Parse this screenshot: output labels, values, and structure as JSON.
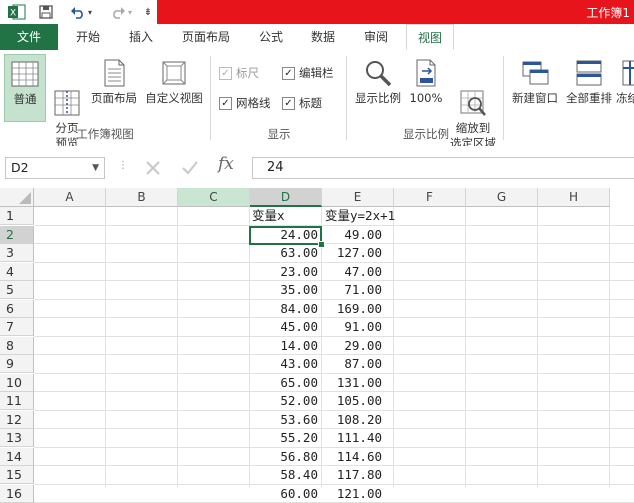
{
  "title_bar": {
    "title": "工作簿1"
  },
  "tabs": [
    "文件",
    "开始",
    "插入",
    "页面布局",
    "公式",
    "数据",
    "审阅",
    "视图"
  ],
  "ribbon": {
    "workbook_views": {
      "group_label": "工作簿视图",
      "buttons": [
        "普通",
        "分页\n预览",
        "页面布局",
        "自定义视图"
      ]
    },
    "show": {
      "group_label": "显示",
      "checkboxes": [
        {
          "label": "标尺",
          "checked": true,
          "disabled": true
        },
        {
          "label": "编辑栏",
          "checked": true,
          "disabled": false
        },
        {
          "label": "网格线",
          "checked": true,
          "disabled": false
        },
        {
          "label": "标题",
          "checked": true,
          "disabled": false
        }
      ]
    },
    "zoom": {
      "group_label": "显示比例",
      "buttons": [
        "显示比例",
        "100%",
        "缩放到\n选定区域"
      ]
    },
    "window": {
      "buttons": [
        "新建窗口",
        "全部重排",
        "冻结"
      ]
    }
  },
  "formula_bar": {
    "name_box": "D2",
    "fx": "fx",
    "value": "24"
  },
  "grid": {
    "columns": [
      "A",
      "B",
      "C",
      "D",
      "E",
      "F",
      "G",
      "H"
    ],
    "rows": [
      "1",
      "2",
      "3",
      "4",
      "5",
      "6",
      "7",
      "8",
      "9",
      "10",
      "11",
      "12",
      "13",
      "14",
      "15",
      "16"
    ],
    "header_row": {
      "D": "变量x",
      "E": "变量y=2x+1"
    },
    "data": [
      [
        "24.00",
        "49.00"
      ],
      [
        "63.00",
        "127.00"
      ],
      [
        "23.00",
        "47.00"
      ],
      [
        "35.00",
        "71.00"
      ],
      [
        "84.00",
        "169.00"
      ],
      [
        "45.00",
        "91.00"
      ],
      [
        "14.00",
        "29.00"
      ],
      [
        "43.00",
        "87.00"
      ],
      [
        "65.00",
        "131.00"
      ],
      [
        "52.00",
        "105.00"
      ],
      [
        "53.60",
        "108.20"
      ],
      [
        "55.20",
        "111.40"
      ],
      [
        "56.80",
        "114.60"
      ],
      [
        "58.40",
        "117.80"
      ],
      [
        "60.00",
        "121.00"
      ]
    ]
  },
  "colors": {
    "excel_green": "#217346",
    "title_red": "#e8141b",
    "selected_green": "#c5e2cf"
  }
}
